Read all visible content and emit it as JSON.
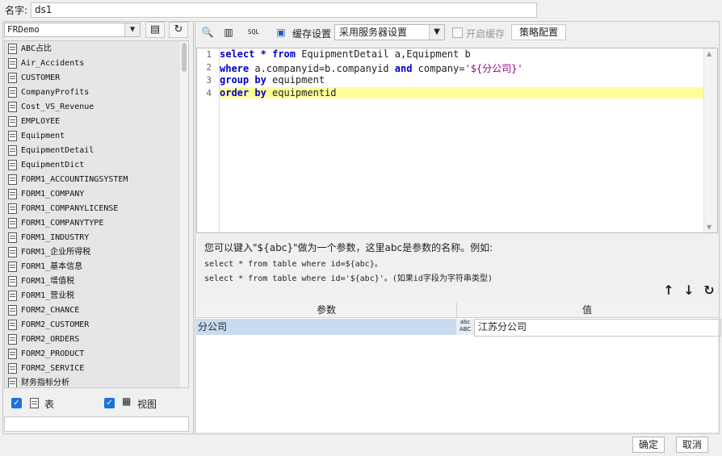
{
  "name_row": {
    "label": "名字:",
    "value": "ds1"
  },
  "left": {
    "database": "FRDemo",
    "tables": [
      "ABC占比",
      "Air_Accidents",
      "CUSTOMER",
      "CompanyProfits",
      "Cost_VS_Revenue",
      "EMPLOYEE",
      "Equipment",
      "EquipmentDetail",
      "EquipmentDict",
      "FORM1_ACCOUNTINGSYSTEM",
      "FORM1_COMPANY",
      "FORM1_COMPANYLICENSE",
      "FORM1_COMPANYTYPE",
      "FORM1_INDUSTRY",
      "FORM1_企业所得税",
      "FORM1_基本信息",
      "FORM1_增值税",
      "FORM1_营业税",
      "FORM2_CHANCE",
      "FORM2_CUSTOMER",
      "FORM2_ORDERS",
      "FORM2_PRODUCT",
      "FORM2_SERVICE",
      "财务指标分析"
    ],
    "check_table_label": "表",
    "check_view_label": "视图"
  },
  "toolbar": {
    "cache_label": "缓存设置",
    "cache_option": "采用服务器设置",
    "enable_cache_label": "开启缓存",
    "strategy_button": "策略配置"
  },
  "editor": {
    "line_numbers": [
      "1",
      "2",
      "3",
      "4"
    ],
    "lines": [
      "select * from EquipmentDetail a,Equipment b",
      "where a.companyid=b.companyid and company='${分公司}'",
      "group by equipment",
      "order by equipmentid"
    ]
  },
  "hint": {
    "line1": "您可以键入\"${abc}\"做为一个参数，这里abc是参数的名称。例如:",
    "line2": "select * from table where id=${abc}。",
    "line3": "select * from table where id='${abc}'。(如果id字段为字符串类型)"
  },
  "params": {
    "col_param": "参数",
    "col_value": "值",
    "rows": [
      {
        "name": "分公司",
        "value": "江苏分公司"
      }
    ]
  },
  "footer": {
    "ok": "确定",
    "cancel": "取消"
  }
}
